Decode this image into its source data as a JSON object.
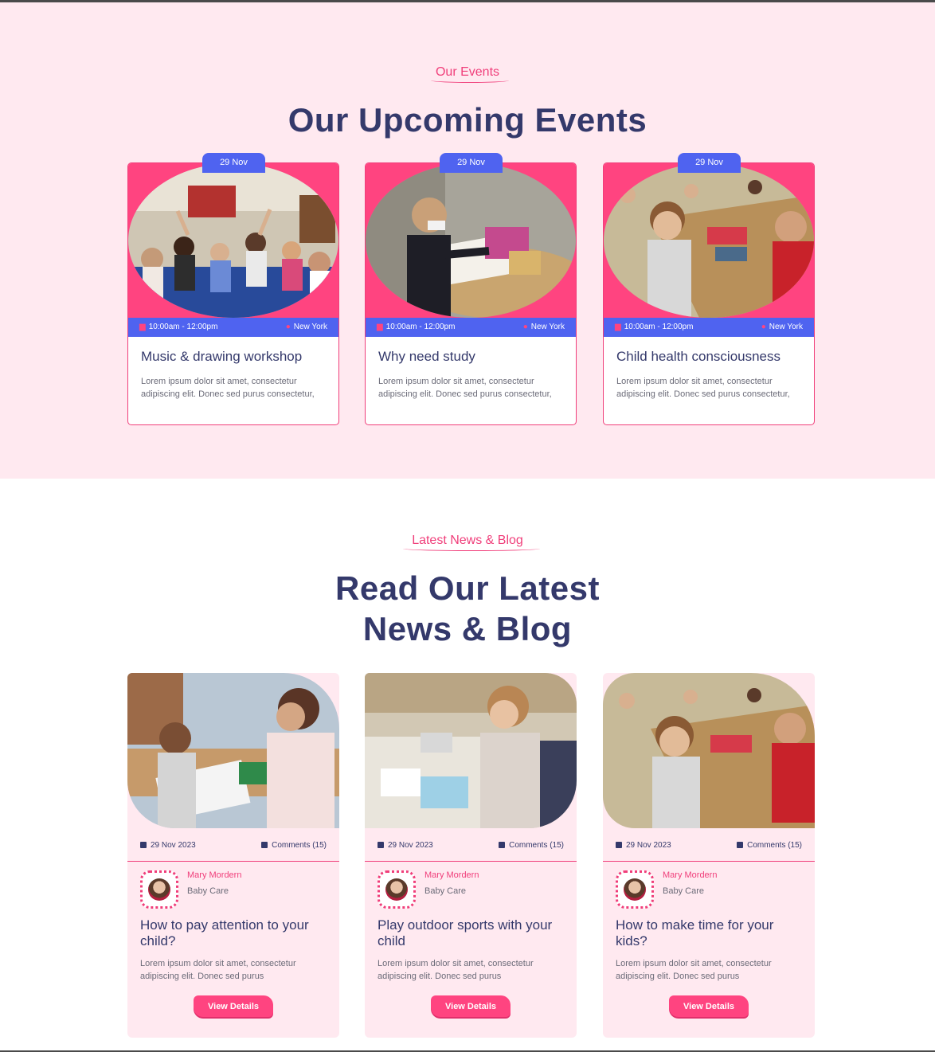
{
  "colors": {
    "accent": "#f03e7a",
    "brand_blue": "#4f63f0",
    "navy": "#34396b",
    "pink_bg": "#ffe9f0"
  },
  "events": {
    "eyebrow": "Our Events",
    "heading": "Our Upcoming Events",
    "cards": [
      {
        "date": "29 Nov",
        "time": "10:00am - 12:00pm",
        "location": "New York",
        "title": "Music & drawing workshop",
        "desc": "Lorem ipsum dolor sit amet, consectetur adipiscing elit. Donec sed purus consectetur,"
      },
      {
        "date": "29 Nov",
        "time": "10:00am - 12:00pm",
        "location": "New York",
        "title": "Why need study",
        "desc": "Lorem ipsum dolor sit amet, consectetur adipiscing elit. Donec sed purus consectetur,"
      },
      {
        "date": "29 Nov",
        "time": "10:00am - 12:00pm",
        "location": "New York",
        "title": "Child health consciousness",
        "desc": "Lorem ipsum dolor sit amet, consectetur adipiscing elit. Donec sed purus consectetur,"
      }
    ]
  },
  "blog": {
    "eyebrow": "Latest News & Blog",
    "heading_line1": "Read Our Latest",
    "heading_line2": "News & Blog",
    "cards": [
      {
        "date": "29 Nov 2023",
        "comments": "Comments (15)",
        "author": "Mary Mordern",
        "role": "Baby Care",
        "title": "How to pay attention to your child?",
        "desc": "Lorem ipsum dolor sit amet, consectetur adipiscing elit. Donec sed purus",
        "button": "View Details"
      },
      {
        "date": "29 Nov 2023",
        "comments": "Comments (15)",
        "author": "Mary Mordern",
        "role": "Baby Care",
        "title": "Play outdoor sports with your child",
        "desc": "Lorem ipsum dolor sit amet, consectetur adipiscing elit. Donec sed purus",
        "button": "View Details"
      },
      {
        "date": "29 Nov 2023",
        "comments": "Comments (15)",
        "author": "Mary Mordern",
        "role": "Baby Care",
        "title": "How to make time for your kids?",
        "desc": "Lorem ipsum dolor sit amet, consectetur adipiscing elit. Donec sed purus",
        "button": "View Details"
      }
    ]
  }
}
